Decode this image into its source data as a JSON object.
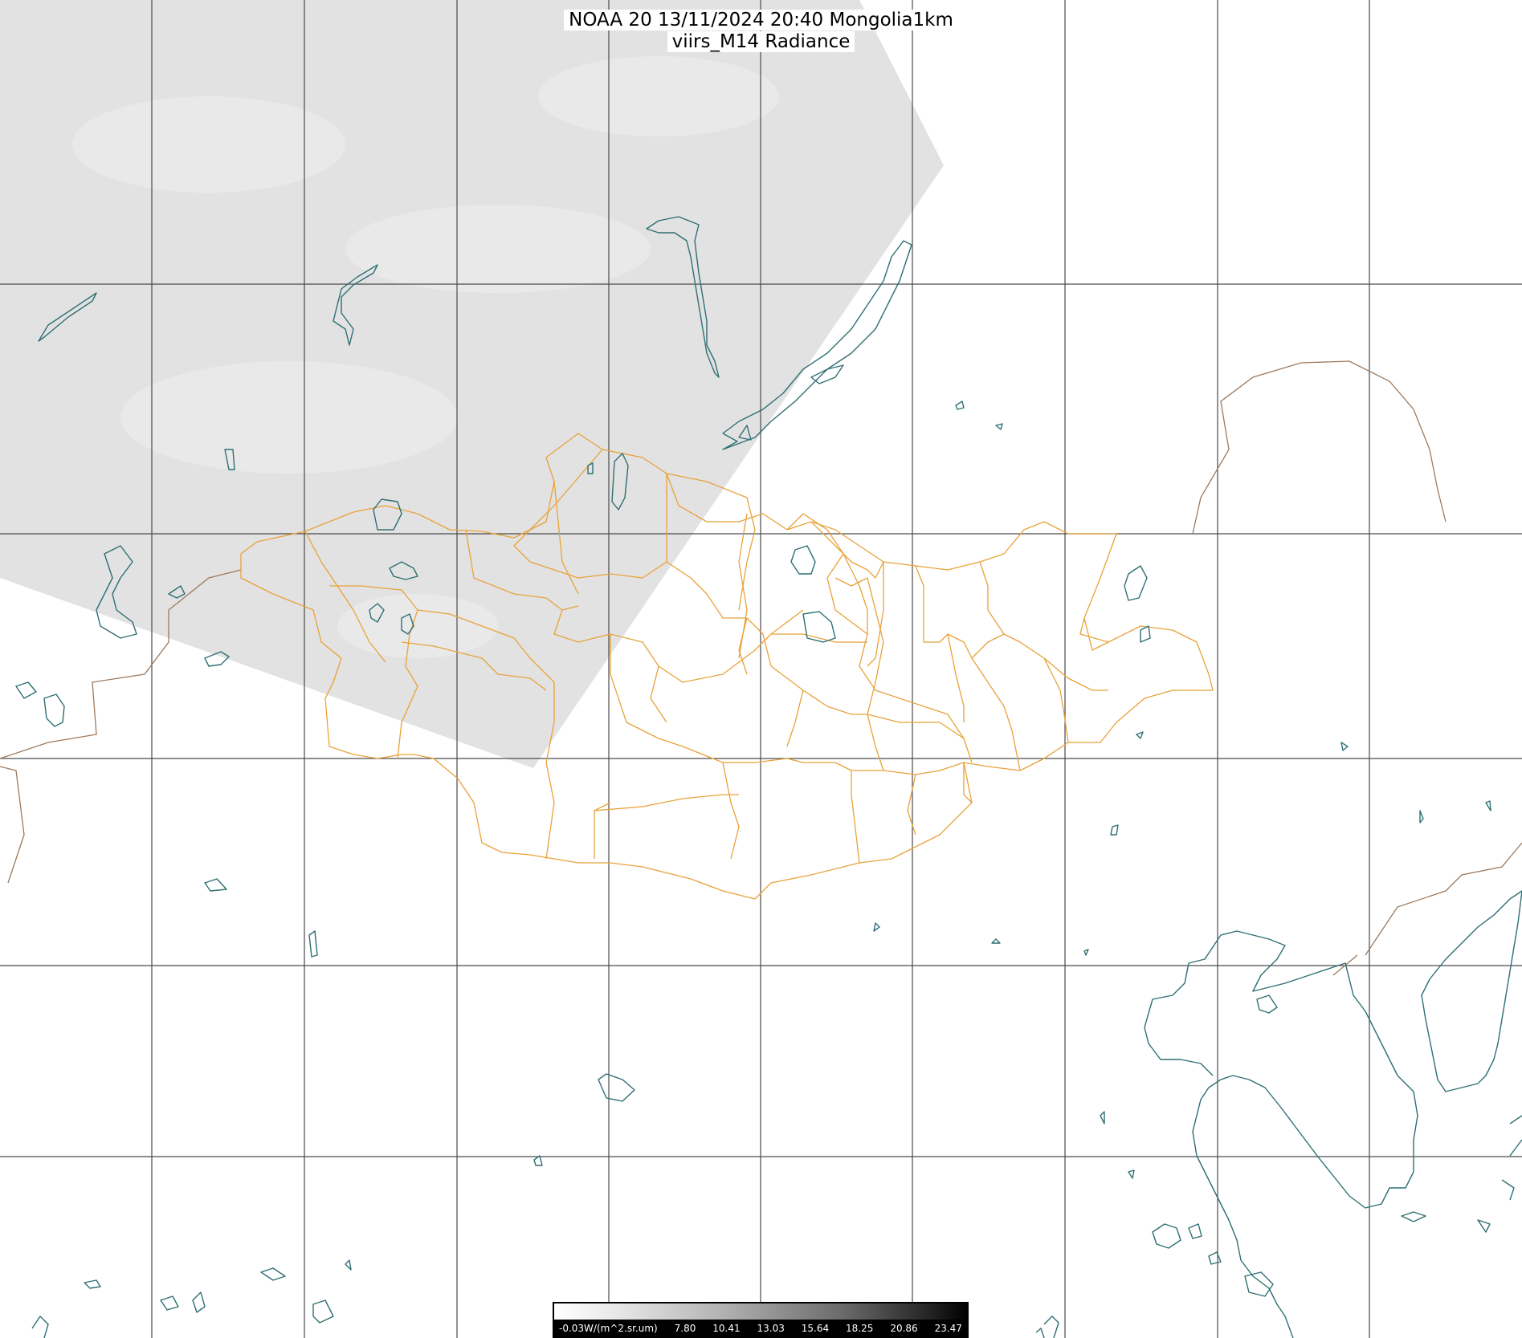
{
  "title": {
    "line1": "NOAA 20 13/11/2024 20:40 Mongolia1km",
    "line2": "viirs_M14 Radiance"
  },
  "colorbar": {
    "labels": [
      "-0.03W/(m^2.sr.um)",
      "7.80",
      "10.41",
      "13.03",
      "15.64",
      "18.25",
      "20.86",
      "23.47"
    ]
  },
  "colors": {
    "background": "#ffffff",
    "swath": "#e2e2e2",
    "grid": "#4a4a4a",
    "province_border": "#e8a23a",
    "country_border": "#9c7a5e",
    "water": "#2f6f73"
  }
}
